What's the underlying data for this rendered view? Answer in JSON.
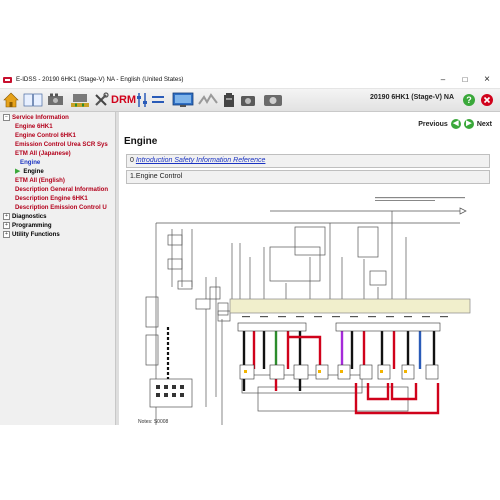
{
  "window": {
    "title": "E-IDSS - 20190 6HK1 (Stage-V)  NA - English (United States)",
    "minimize": "–",
    "maximize": "□",
    "close": "×"
  },
  "toolbar": {
    "icons": [
      "home-icon",
      "book-icon",
      "engine-icon",
      "sensor-icon",
      "tools-icon",
      "drm-icon",
      "sliders-icon",
      "list-icon",
      "monitor-icon",
      "signal-icon",
      "battery-icon",
      "camera-icon"
    ],
    "drm_label": "DRM",
    "model_label": "20190 6HK1 (Stage-V)  NA",
    "colors": {
      "accent_red": "#d0021b",
      "help_green": "#3aa83a"
    }
  },
  "sidebar": {
    "items": [
      {
        "label": "Service Information",
        "indent": 0,
        "color": "red",
        "bold": true,
        "expander": "minus"
      },
      {
        "label": "Engine 6HK1",
        "indent": 1,
        "color": "red",
        "bold": true
      },
      {
        "label": "Engine Control 6HK1",
        "indent": 1,
        "color": "red",
        "bold": true
      },
      {
        "label": "Emission Control Urea SCR Sys",
        "indent": 1,
        "color": "red",
        "bold": true
      },
      {
        "label": "ETM All (Japanese)",
        "indent": 1,
        "color": "red",
        "bold": true
      },
      {
        "label": "Engine",
        "indent": 2,
        "color": "blue",
        "bold": true
      },
      {
        "label": "Engine",
        "indent": 1,
        "color": "black",
        "bold": true,
        "play_marker": true
      },
      {
        "label": "ETM All (English)",
        "indent": 1,
        "color": "red",
        "bold": true
      },
      {
        "label": "Description General Information",
        "indent": 1,
        "color": "red",
        "bold": true
      },
      {
        "label": "Description Engine 6HK1",
        "indent": 1,
        "color": "red",
        "bold": true
      },
      {
        "label": "Description Emission Control U",
        "indent": 1,
        "color": "red",
        "bold": true
      },
      {
        "label": "Diagnostics",
        "indent": 0,
        "color": "black",
        "bold": true,
        "expander": "plus"
      },
      {
        "label": "Programming",
        "indent": 0,
        "color": "black",
        "bold": true,
        "expander": "plus"
      },
      {
        "label": "Utility Functions",
        "indent": 0,
        "color": "black",
        "bold": true,
        "expander": "plus"
      }
    ]
  },
  "main": {
    "nav": {
      "previous": "Previous",
      "next": "Next"
    },
    "page_title": "Engine",
    "sections": [
      {
        "number": "0",
        "label": "Introduction Safety Information Reference",
        "link": true
      },
      {
        "number": "1",
        "label": "Engine Control",
        "link": false
      }
    ],
    "diagram_caption": "Notes: S0008"
  }
}
